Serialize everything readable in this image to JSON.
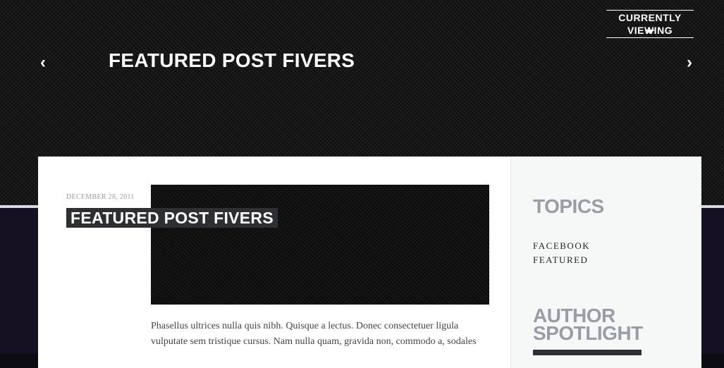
{
  "header": {
    "currently_viewing": "CURRENTLY VIEWING",
    "title": "FEATURED POST FIVERS",
    "prev_icon": "chevron-left-icon",
    "next_icon": "chevron-right-icon"
  },
  "post": {
    "date": "DECEMBER 28, 2011",
    "title": "FEATURED POST FIVERS",
    "excerpt": "Phasellus ultrices nulla quis nibh. Quisque a lectus. Donec consectetuer ligula vulputate sem tristique cursus. Nam nulla quam, gravida non, commodo a, sodales"
  },
  "sidebar": {
    "topics_heading": "TOPICS",
    "topics": [
      {
        "label": "FACEBOOK"
      },
      {
        "label": "FEATURED"
      }
    ],
    "author_heading": "AUTHOR SPOTLIGHT"
  },
  "colors": {
    "hero_bg": "#141414",
    "lower_bg": "#151123",
    "card_bg": "#ffffff",
    "sidebar_bg": "#f6f8f8",
    "heading_gray": "#9a9ca6",
    "title_block": "#2d2f33"
  }
}
